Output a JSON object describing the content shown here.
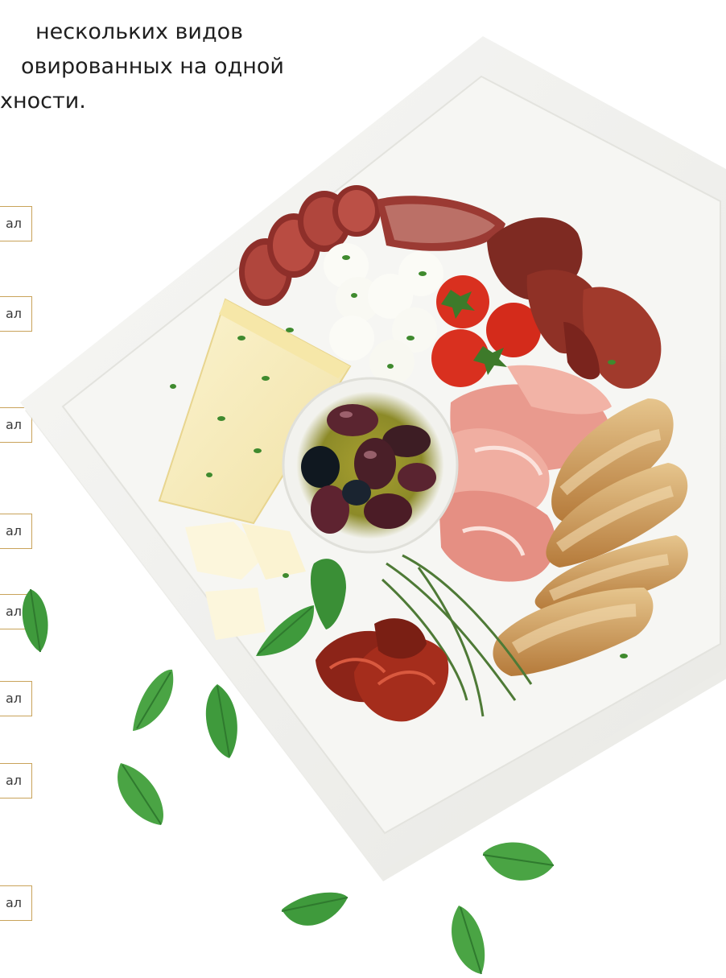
{
  "intro": {
    "line1": "нескольких видов",
    "line2": "овированных на одной",
    "line3": "хности."
  },
  "menu_buttons": [
    {
      "label": "ал"
    },
    {
      "label": "ал"
    },
    {
      "label": "ал"
    },
    {
      "label": "ал"
    },
    {
      "label": "ал"
    },
    {
      "label": "ал"
    },
    {
      "label": "ал"
    },
    {
      "label": "ал"
    }
  ],
  "colors": {
    "accent_border": "#c9a35a",
    "text": "#1f1f1f",
    "plate": "#f2f2ef",
    "basil": "#3f9a3c"
  },
  "image": {
    "subject": "antipasto-plate-photo"
  }
}
